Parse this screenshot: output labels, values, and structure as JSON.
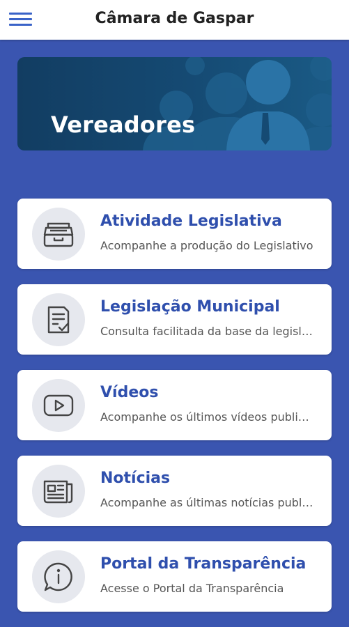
{
  "header": {
    "title": "Câmara de Gaspar",
    "menu_icon": "hamburger-menu-icon"
  },
  "banner": {
    "title": "Vereadores"
  },
  "menu": {
    "items": [
      {
        "title": "Atividade Legislativa",
        "subtitle": "Acompanhe a produção do Legislativo",
        "icon": "inbox-tray-icon"
      },
      {
        "title": "Legislação Municipal",
        "subtitle": "Consulta facilitada da base da legislação",
        "icon": "document-check-icon"
      },
      {
        "title": "Vídeos",
        "subtitle": "Acompanhe os últimos vídeos publicados",
        "icon": "video-play-icon"
      },
      {
        "title": "Notícias",
        "subtitle": "Acompanhe as últimas notícias publicadas",
        "icon": "newspaper-icon"
      },
      {
        "title": "Portal da Transparência",
        "subtitle": "Acesse o Portal da Transparência",
        "icon": "info-chat-icon"
      }
    ]
  },
  "colors": {
    "background": "#3a55b0",
    "accent": "#2f4fad",
    "banner": "#154a73",
    "icon_circle": "#e6e8ee"
  }
}
